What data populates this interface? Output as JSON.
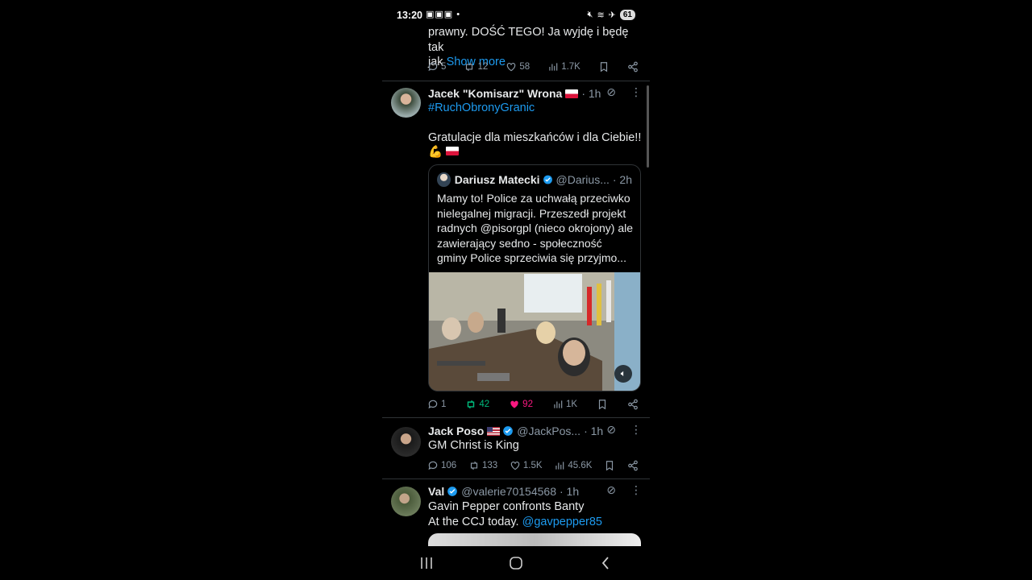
{
  "status": {
    "time": "13:20",
    "left_icons": "▣▣▣ •",
    "battery": "61"
  },
  "tweet0": {
    "text_line1": "prawny. DOŚĆ TEGO! Ja wyjdę i będę tak",
    "text_line2": "jak",
    "show_more": "Show more",
    "replies": "5",
    "reposts": "12",
    "likes": "58",
    "views": "1.7K"
  },
  "tweet1": {
    "name": "Jacek \"Komisarz\" Wrona",
    "time": "· 1h",
    "hashtag": "#RuchObronyGranic",
    "text": "Gratulacje dla mieszkańców i dla Ciebie!!",
    "emoji_line": "💪",
    "quote": {
      "name": "Dariusz Matecki",
      "handle": "@Darius...",
      "time": "· 2h",
      "text": "Mamy to! Police za uchwałą przeciwko nielegalnej migracji. Przeszedł projekt radnych @pisorgpl (nieco okrojony) ale zawierający sedno - społeczność gminy Police sprzeciwia się przyjmo..."
    },
    "replies": "1",
    "reposts": "42",
    "likes": "92",
    "views": "1K"
  },
  "tweet2": {
    "name": "Jack Poso",
    "handle": "@JackPos...",
    "time": "· 1h",
    "text": "GM Christ is King",
    "replies": "106",
    "reposts": "133",
    "likes": "1.5K",
    "views": "45.6K"
  },
  "tweet3": {
    "name": "Val",
    "handle": "@valerie70154568",
    "time": "· 1h",
    "text_line1": "Gavin Pepper confronts Banty",
    "text_line2": "At the CCJ today.",
    "mention": "@gavpepper85"
  },
  "colors": {
    "link": "#1d9bf0",
    "repost_active": "#00ba7c",
    "like_active": "#f91880",
    "muted": "#8b98a5"
  }
}
